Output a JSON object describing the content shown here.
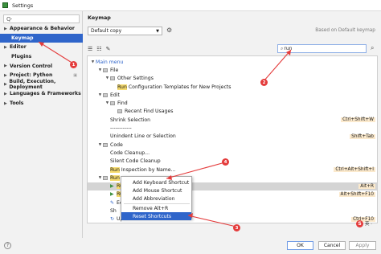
{
  "window": {
    "title": "Settings"
  },
  "sidebar": {
    "search_value": "Q·",
    "items": [
      {
        "label": "Appearance & Behavior",
        "arrow": "▶"
      },
      {
        "label": "Keymap"
      },
      {
        "label": "Editor",
        "arrow": "▶"
      },
      {
        "label": "Plugins"
      },
      {
        "label": "Version Control",
        "arrow": "▶"
      },
      {
        "label": "Project: Python",
        "arrow": "▶"
      },
      {
        "label": "Build, Execution, Deployment",
        "arrow": "▶"
      },
      {
        "label": "Languages & Frameworks",
        "arrow": "▶"
      },
      {
        "label": "Tools",
        "arrow": "▶"
      }
    ]
  },
  "main": {
    "title": "Keymap",
    "scheme": "Default copy",
    "based_on": "Based on Default keymap",
    "filter_value": "run"
  },
  "tree": [
    {
      "label": "Main menu",
      "blue": true,
      "toggle": "▼",
      "level": 0
    },
    {
      "label": "File",
      "toggle": "▼",
      "level": 1,
      "folder": true
    },
    {
      "label": "Other Settings",
      "toggle": "▼",
      "level": 2,
      "folder": true
    },
    {
      "pre": "",
      "hl": "Run",
      "post": " Configuration Templates for New Projects",
      "level": 3
    },
    {
      "label": "Edit",
      "toggle": "▼",
      "level": 1,
      "folder": true
    },
    {
      "label": "Find",
      "toggle": "▼",
      "level": 2,
      "folder": true
    },
    {
      "label": "Recent Find Usages",
      "level": 3,
      "folder": true
    },
    {
      "label": "Shrink Selection",
      "level": 2,
      "shortcut": "Ctrl+Shift+W"
    },
    {
      "label": "------------",
      "level": 2
    },
    {
      "label": "Unindent Line or Selection",
      "level": 2,
      "shortcut": "Shift+Tab"
    },
    {
      "label": "Code",
      "toggle": "▼",
      "level": 1,
      "folder": true
    },
    {
      "label": "Code Cleanup...",
      "level": 2
    },
    {
      "label": "Silent Code Cleanup",
      "level": 2
    },
    {
      "pre": "",
      "hl": "Run",
      "post": " Inspection by Name...",
      "level": 2,
      "shortcut": "Ctrl+Alt+Shift+I"
    },
    {
      "pre": "",
      "hl": "Run",
      "post": "",
      "toggle": "▼",
      "level": 1,
      "folder": true
    },
    {
      "pre": "",
      "hl": "Ru",
      "post": "",
      "level": 2,
      "act": "▶",
      "shortcut": "Alt+R",
      "selected": true
    },
    {
      "pre": "",
      "hl": "Ru",
      "post": "",
      "level": 2,
      "act": "▶",
      "shortcut": "Alt+Shift+F10"
    },
    {
      "pre": "Ec",
      "hl": "",
      "post": "",
      "level": 2,
      "act": "✎"
    },
    {
      "pre": "Sh",
      "hl": "",
      "post": "",
      "level": 2
    },
    {
      "pre": "Up",
      "hl": "",
      "post": "",
      "level": 2,
      "act": "↻",
      "shortcut": "Ctrl+F10"
    },
    {
      "pre": "",
      "hl": "Ru",
      "post": "",
      "level": 2,
      "act": "▶",
      "shortcut": "Ctrl+Shift+F10"
    },
    {
      "pre": "Force ",
      "hl": "Run",
      "post": " to Cursor",
      "level": 2,
      "act": "↳",
      "shortcut": "Ctrl+Alt+F9"
    }
  ],
  "context_menu": {
    "items": [
      "Add Keyboard Shortcut",
      "Add Mouse Shortcut",
      "Add Abbreviation",
      "Remove Alt+R",
      "Reset Shortcuts"
    ]
  },
  "buttons": {
    "ok": "OK",
    "cancel": "Cancel",
    "apply": "Apply",
    "help": "?"
  },
  "annotations": [
    "1",
    "2",
    "3",
    "4"
  ],
  "ime": {
    "s_label": "S",
    "text": "英 ·"
  },
  "colors": {
    "accent": "#2f65ca",
    "highlight": "#f7dc6f",
    "annotation": "#e43c3c"
  }
}
